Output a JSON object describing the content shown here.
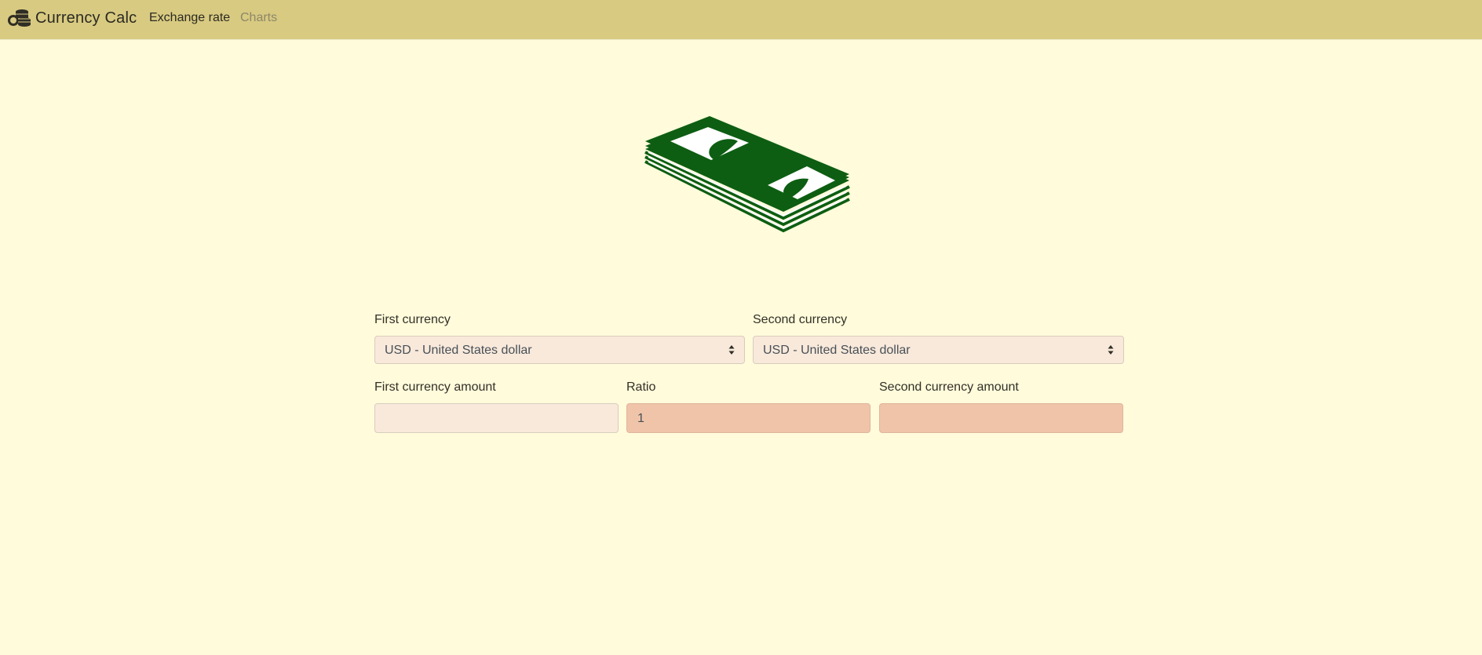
{
  "navbar": {
    "brand_icon": "coins-icon",
    "brand_text": "Currency Calc",
    "links": [
      {
        "label": "Exchange rate",
        "active": true
      },
      {
        "label": "Charts",
        "active": false
      }
    ],
    "background_color": "#d8ca81"
  },
  "hero": {
    "icon": "money-stack-icon",
    "color": "#0d5e12"
  },
  "form": {
    "first_currency_label": "First currency",
    "first_currency_value": "USD - United States dollar",
    "second_currency_label": "Second currency",
    "second_currency_value": "USD - United States dollar",
    "first_amount_label": "First currency amount",
    "first_amount_value": "",
    "ratio_label": "Ratio",
    "ratio_value": "1",
    "second_amount_label": "Second currency amount",
    "second_amount_value": ""
  },
  "colors": {
    "page_background": "#fffbdb",
    "field_background": "#f8e9db",
    "readonly_background": "#efc4a9"
  }
}
